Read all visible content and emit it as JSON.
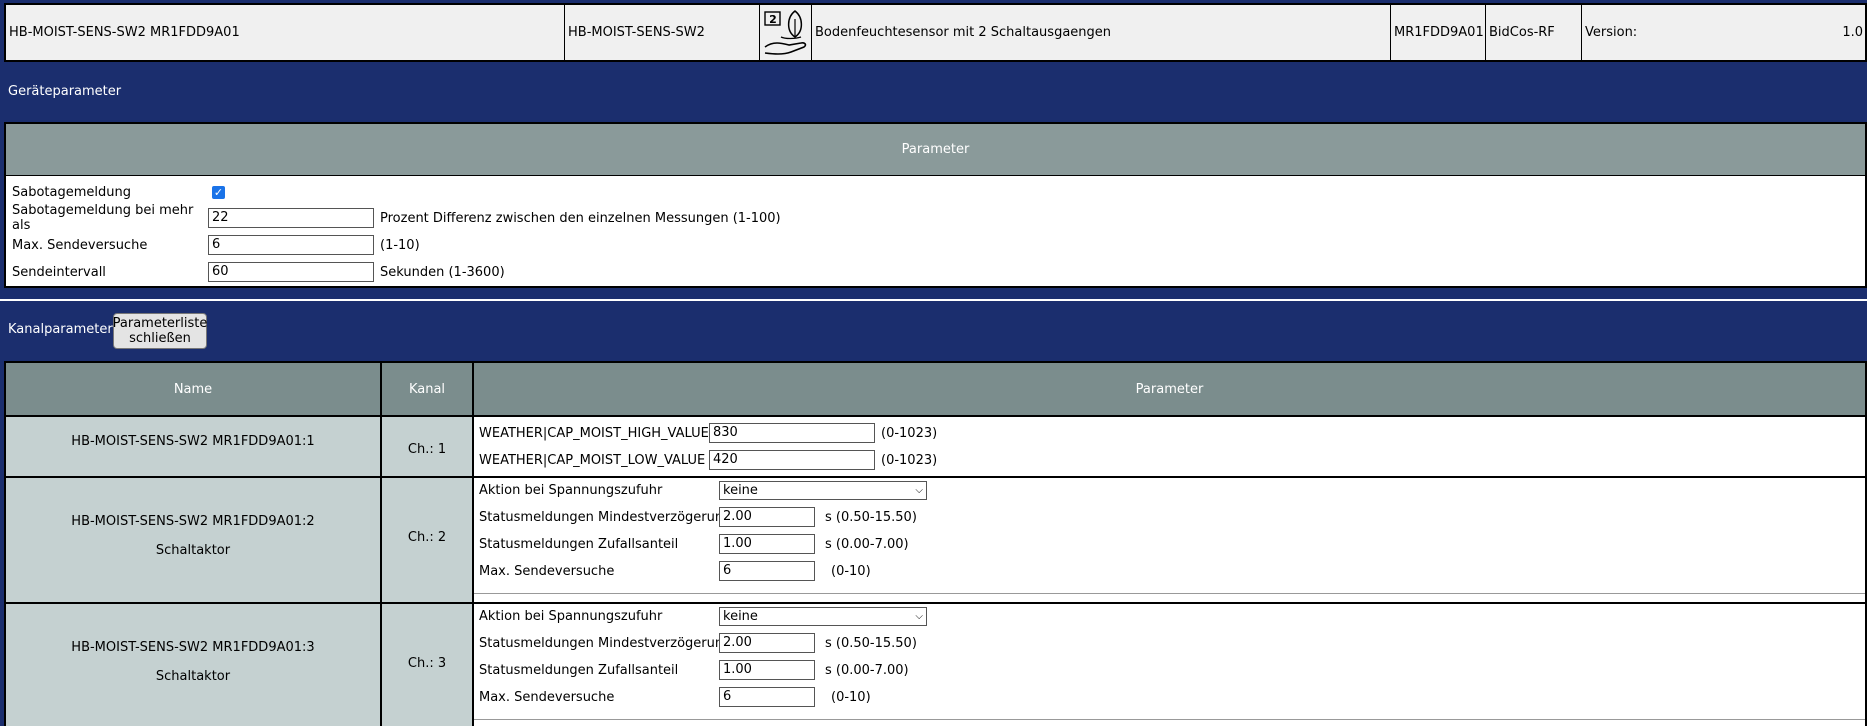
{
  "device": {
    "name": "HB-MOIST-SENS-SW2 MR1FDD9A01",
    "type": "HB-MOIST-SENS-SW2",
    "icon_badge": "2",
    "description": "Bodenfeuchtesensor mit 2 Schaltausgaengen",
    "serial": "MR1FDD9A01",
    "interface": "BidCos-RF",
    "version_label": "Version:",
    "version_value": "1.0"
  },
  "device_params": {
    "section_title": "Geräteparameter",
    "header": "Parameter",
    "rows": [
      {
        "label": "Sabotagemeldung",
        "checked": true
      },
      {
        "label": "Sabotagemeldung bei mehr als",
        "value": "22",
        "hint": "Prozent Differenz zwischen den einzelnen Messungen (1-100)"
      },
      {
        "label": "Max. Sendeversuche",
        "value": "6",
        "hint": "(1-10)"
      },
      {
        "label": "Sendeintervall",
        "value": "60",
        "hint": "Sekunden (1-3600)"
      }
    ]
  },
  "channel_params": {
    "section_title": "Kanalparameter",
    "close_button": "Parameterliste schließen",
    "close_button_line1": "Parameterliste",
    "close_button_line2": "schließen",
    "headers": {
      "name": "Name",
      "kanal": "Kanal",
      "parameter": "Parameter"
    },
    "channels": [
      {
        "name": "HB-MOIST-SENS-SW2 MR1FDD9A01:1",
        "subtitle": "",
        "kanal": "Ch.: 1",
        "params": [
          {
            "label": "WEATHER|CAP_MOIST_HIGH_VALUE",
            "value": "830",
            "hint": "(0-1023)"
          },
          {
            "label": "WEATHER|CAP_MOIST_LOW_VALUE",
            "value": "420",
            "hint": "(0-1023)"
          }
        ]
      },
      {
        "name": "HB-MOIST-SENS-SW2 MR1FDD9A01:2",
        "subtitle": "Schaltaktor",
        "kanal": "Ch.: 2",
        "params": [
          {
            "label": "Aktion bei Spannungszufuhr",
            "select": "keine"
          },
          {
            "label": "Statusmeldungen Mindestverzögerung",
            "value": "2.00",
            "hint": "s (0.50-15.50)"
          },
          {
            "label": "Statusmeldungen Zufallsanteil",
            "value": "1.00",
            "hint": "s (0.00-7.00)"
          },
          {
            "label": "Max. Sendeversuche",
            "value": "6",
            "hint": "(0-10)"
          }
        ]
      },
      {
        "name": "HB-MOIST-SENS-SW2 MR1FDD9A01:3",
        "subtitle": "Schaltaktor",
        "kanal": "Ch.: 3",
        "params": [
          {
            "label": "Aktion bei Spannungszufuhr",
            "select": "keine"
          },
          {
            "label": "Statusmeldungen Mindestverzögerung",
            "value": "2.00",
            "hint": "s (0.50-15.50)"
          },
          {
            "label": "Statusmeldungen Zufallsanteil",
            "value": "1.00",
            "hint": "s (0.00-7.00)"
          },
          {
            "label": "Max. Sendeversuche",
            "value": "6",
            "hint": "(0-10)"
          }
        ]
      }
    ]
  },
  "icons": {
    "device_icon": "plant-hand-icon",
    "checkbox": "checkmark-icon",
    "select_arrow": "chevron-down-icon"
  }
}
